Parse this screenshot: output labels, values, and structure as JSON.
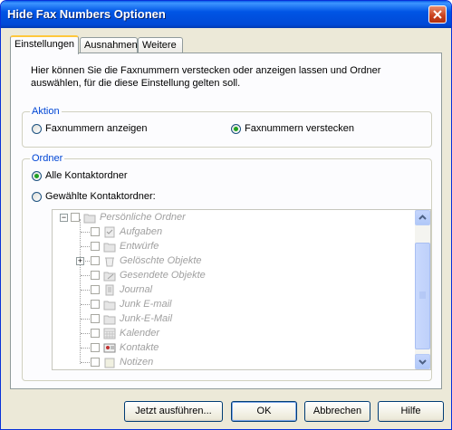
{
  "window": {
    "title": "Hide Fax Numbers Optionen"
  },
  "tabs": [
    {
      "label": "Einstellungen"
    },
    {
      "label": "Ausnahmen"
    },
    {
      "label": "Weitere"
    }
  ],
  "description": "Hier können Sie die Faxnummern verstecken oder anzeigen lassen und Ordner auswählen, für die diese Einstellung gelten soll.",
  "aktion": {
    "label": "Aktion",
    "options": [
      {
        "label": "Faxnummern anzeigen",
        "selected": false
      },
      {
        "label": "Faxnummern verstecken",
        "selected": true
      }
    ]
  },
  "ordner": {
    "label": "Ordner",
    "options": [
      {
        "label": "Alle Kontaktordner",
        "selected": true
      },
      {
        "label": "Gewählte Kontaktordner:",
        "selected": false
      }
    ],
    "tree": {
      "root": {
        "label": "Persönliche Ordner",
        "icon": "folder-tree-icon"
      },
      "items": [
        {
          "label": "Aufgaben",
          "icon": "tasks-icon"
        },
        {
          "label": "Entwürfe",
          "icon": "folder-icon"
        },
        {
          "label": "Gelöschte Objekte",
          "icon": "trash-icon"
        },
        {
          "label": "Gesendete Objekte",
          "icon": "sent-icon"
        },
        {
          "label": "Journal",
          "icon": "journal-icon"
        },
        {
          "label": "Junk E-mail",
          "icon": "folder-icon"
        },
        {
          "label": "Junk-E-Mail",
          "icon": "folder-icon"
        },
        {
          "label": "Kalender",
          "icon": "calendar-icon"
        },
        {
          "label": "Kontakte",
          "icon": "contacts-icon"
        },
        {
          "label": "Notizen",
          "icon": "notes-icon"
        }
      ]
    }
  },
  "buttons": {
    "run": "Jetzt ausführen...",
    "ok": "OK",
    "cancel": "Abbrechen",
    "help": "Hilfe"
  }
}
